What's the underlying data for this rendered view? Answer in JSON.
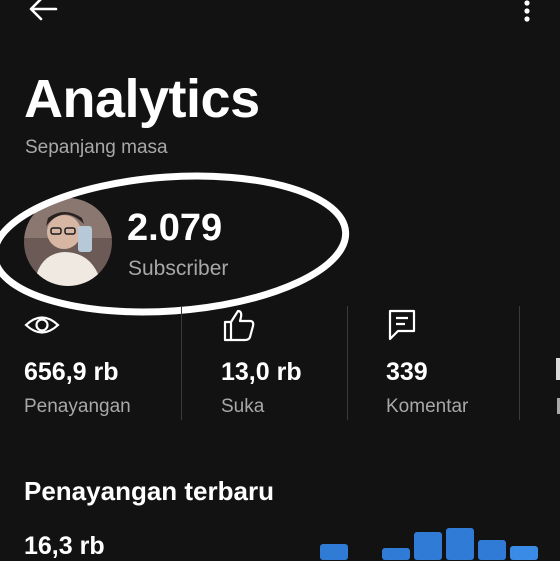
{
  "header": {
    "title": "Analytics",
    "period": "Sepanjang masa"
  },
  "subscribers": {
    "count": "2.079",
    "label": "Subscriber"
  },
  "stats": [
    {
      "icon": "eye-icon",
      "value": "656,9 rb",
      "label": "Penayangan"
    },
    {
      "icon": "thumbs-up-icon",
      "value": "13,0 rb",
      "label": "Suka"
    },
    {
      "icon": "comment-icon",
      "value": "339",
      "label": "Komentar"
    }
  ],
  "recent": {
    "title": "Penayangan terbaru",
    "value": "16,3 rb"
  },
  "colors": {
    "background": "#121212",
    "accent_bar": "#2f7bd6",
    "muted_text": "#a8a8a8"
  }
}
